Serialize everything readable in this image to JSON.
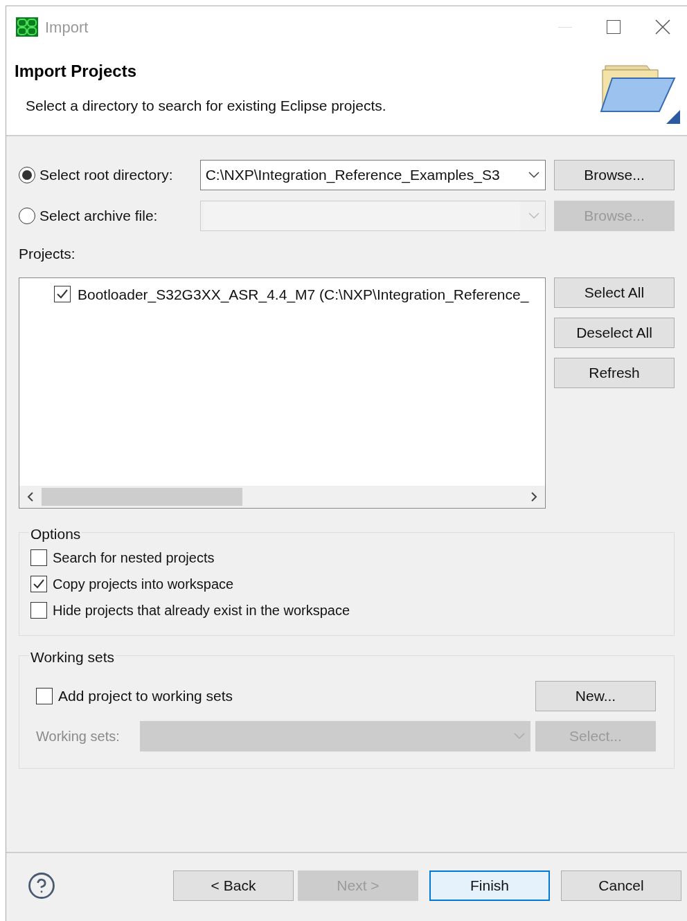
{
  "window": {
    "title": "Import"
  },
  "header": {
    "title": "Import Projects",
    "description": "Select a directory to search for existing Eclipse projects."
  },
  "source": [
    {
      "label": "Select root directory:",
      "selected": true,
      "value": "C:\\NXP\\Integration_Reference_Examples_S3",
      "disabled": false,
      "browse": {
        "label": "Browse...",
        "disabled": false
      }
    },
    {
      "label": "Select archive file:",
      "selected": false,
      "disabled": true,
      "browse": {
        "label": "Browse...",
        "disabled": true
      }
    }
  ],
  "projects": {
    "label": "Projects:",
    "items": [
      {
        "label": "Bootloader_S32G3XX_ASR_4.4_M7 (C:\\NXP\\Integration_Reference_",
        "checked": true
      }
    ],
    "buttons": [
      {
        "label": "Select All"
      },
      {
        "label": "Deselect All"
      },
      {
        "label": "Refresh"
      }
    ]
  },
  "options": {
    "title": "Options",
    "items": [
      {
        "label": "Search for nested projects",
        "checked": false
      },
      {
        "label": "Copy projects into workspace",
        "checked": true
      },
      {
        "label": "Hide projects that already exist in the workspace",
        "checked": false
      }
    ]
  },
  "working_sets": {
    "title": "Working sets",
    "add": {
      "label": "Add project to working sets",
      "checked": false
    },
    "new_button": {
      "label": "New...",
      "disabled": false
    },
    "field": {
      "label": "Working sets:",
      "disabled": true
    },
    "select_button": {
      "label": "Select...",
      "disabled": true
    }
  },
  "footer": {
    "buttons": [
      {
        "label": "< Back",
        "disabled": false,
        "default": false
      },
      {
        "label": "Next >",
        "disabled": true,
        "default": false
      },
      {
        "label": "Finish",
        "disabled": false,
        "default": true
      },
      {
        "label": "Cancel",
        "disabled": false,
        "default": false
      }
    ]
  }
}
